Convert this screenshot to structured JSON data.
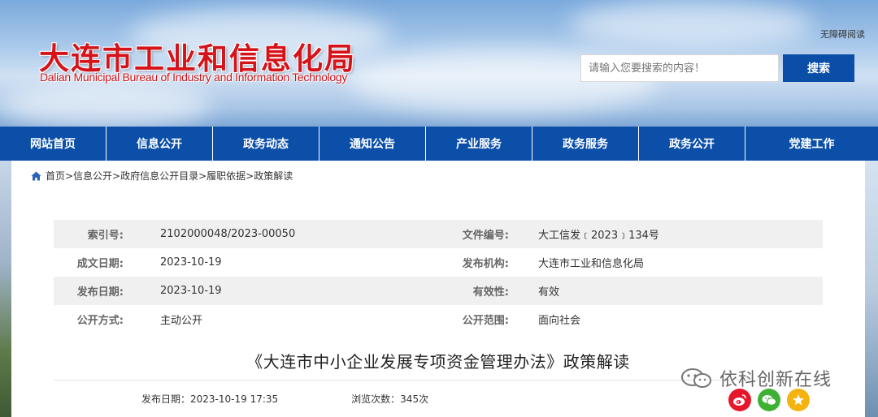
{
  "header": {
    "title_cn": "大连市工业和信息化局",
    "title_en": "Dalian Municipal Bureau of Industry and Information Technology",
    "accessible_reading": "无障碍阅读",
    "search_placeholder": "请输入您要搜索的内容！",
    "search_button": "搜索"
  },
  "nav": {
    "items": [
      "网站首页",
      "信息公开",
      "政务动态",
      "通知公告",
      "产业服务",
      "政务服务",
      "政务公开",
      "党建工作"
    ]
  },
  "breadcrumb": "首页>信息公开>政府信息公开目录>履职依据>政策解读",
  "meta": {
    "rows": [
      {
        "label1": "索引号:",
        "value1": "2102000048/2023-00050",
        "label2": "文件编号:",
        "value2": "大工信发﹝2023﹞134号"
      },
      {
        "label1": "成文日期:",
        "value1": "2023-10-19",
        "label2": "发布机构:",
        "value2": "大连市工业和信息化局"
      },
      {
        "label1": "发布日期:",
        "value1": "2023-10-19",
        "label2": "有效性:",
        "value2": "有效"
      },
      {
        "label1": "公开方式:",
        "value1": "主动公开",
        "label2": "公开范围:",
        "value2": "面向社会"
      }
    ]
  },
  "article": {
    "title": "《大连市中小企业发展专项资金管理办法》政策解读",
    "publish_date_label": "发布日期：",
    "publish_date_value": "2023-10-19  17:35",
    "views_label": "浏览次数：",
    "views_value": "345次"
  },
  "watermark": "依科创新在线",
  "colors": {
    "nav_bg": "#0b4fa8",
    "title_red": "#d4141a",
    "search_button_bg": "#0a4ea8"
  }
}
